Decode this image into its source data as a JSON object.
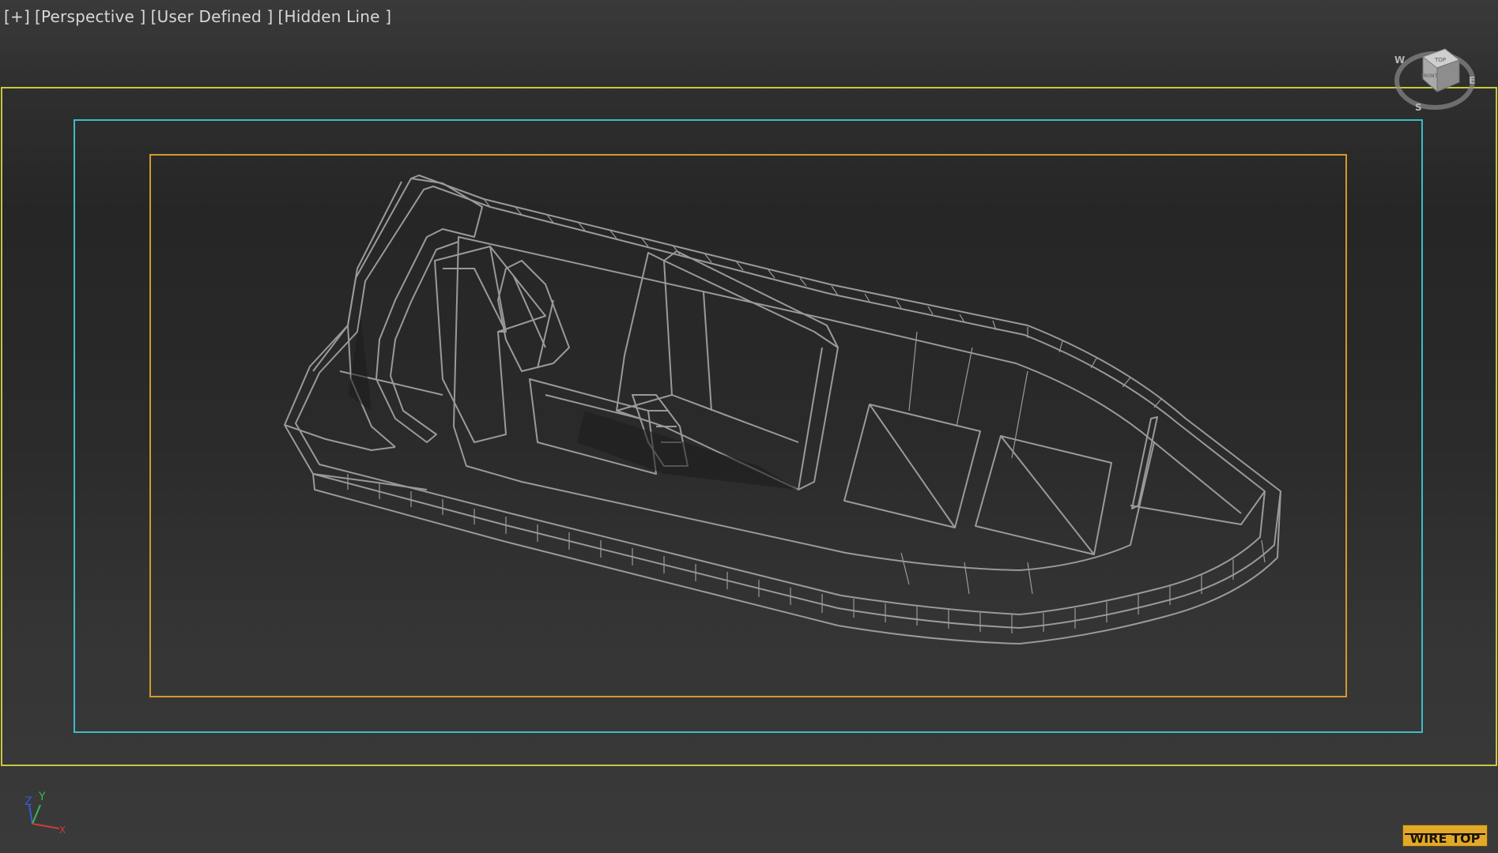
{
  "viewport": {
    "labels": {
      "plus": "[+]",
      "view": "[Perspective ]",
      "camera": "[User Defined ]",
      "style": "[Hidden Line ]"
    },
    "viewcube": {
      "face_top": "TOP",
      "face_front": "FRONT",
      "compass_w": "W",
      "compass_s": "S",
      "compass_e": "E"
    },
    "axis": {
      "z": "Z",
      "y": "Y",
      "x": "X"
    },
    "badge": "WIRE TOP"
  },
  "colors": {
    "safe_frame_outer": "#c8c840",
    "safe_frame_action": "#3cbcc8",
    "safe_frame_title": "#d49a2a",
    "wireframe": "#9a9a9a",
    "badge": "#e0a92a"
  }
}
